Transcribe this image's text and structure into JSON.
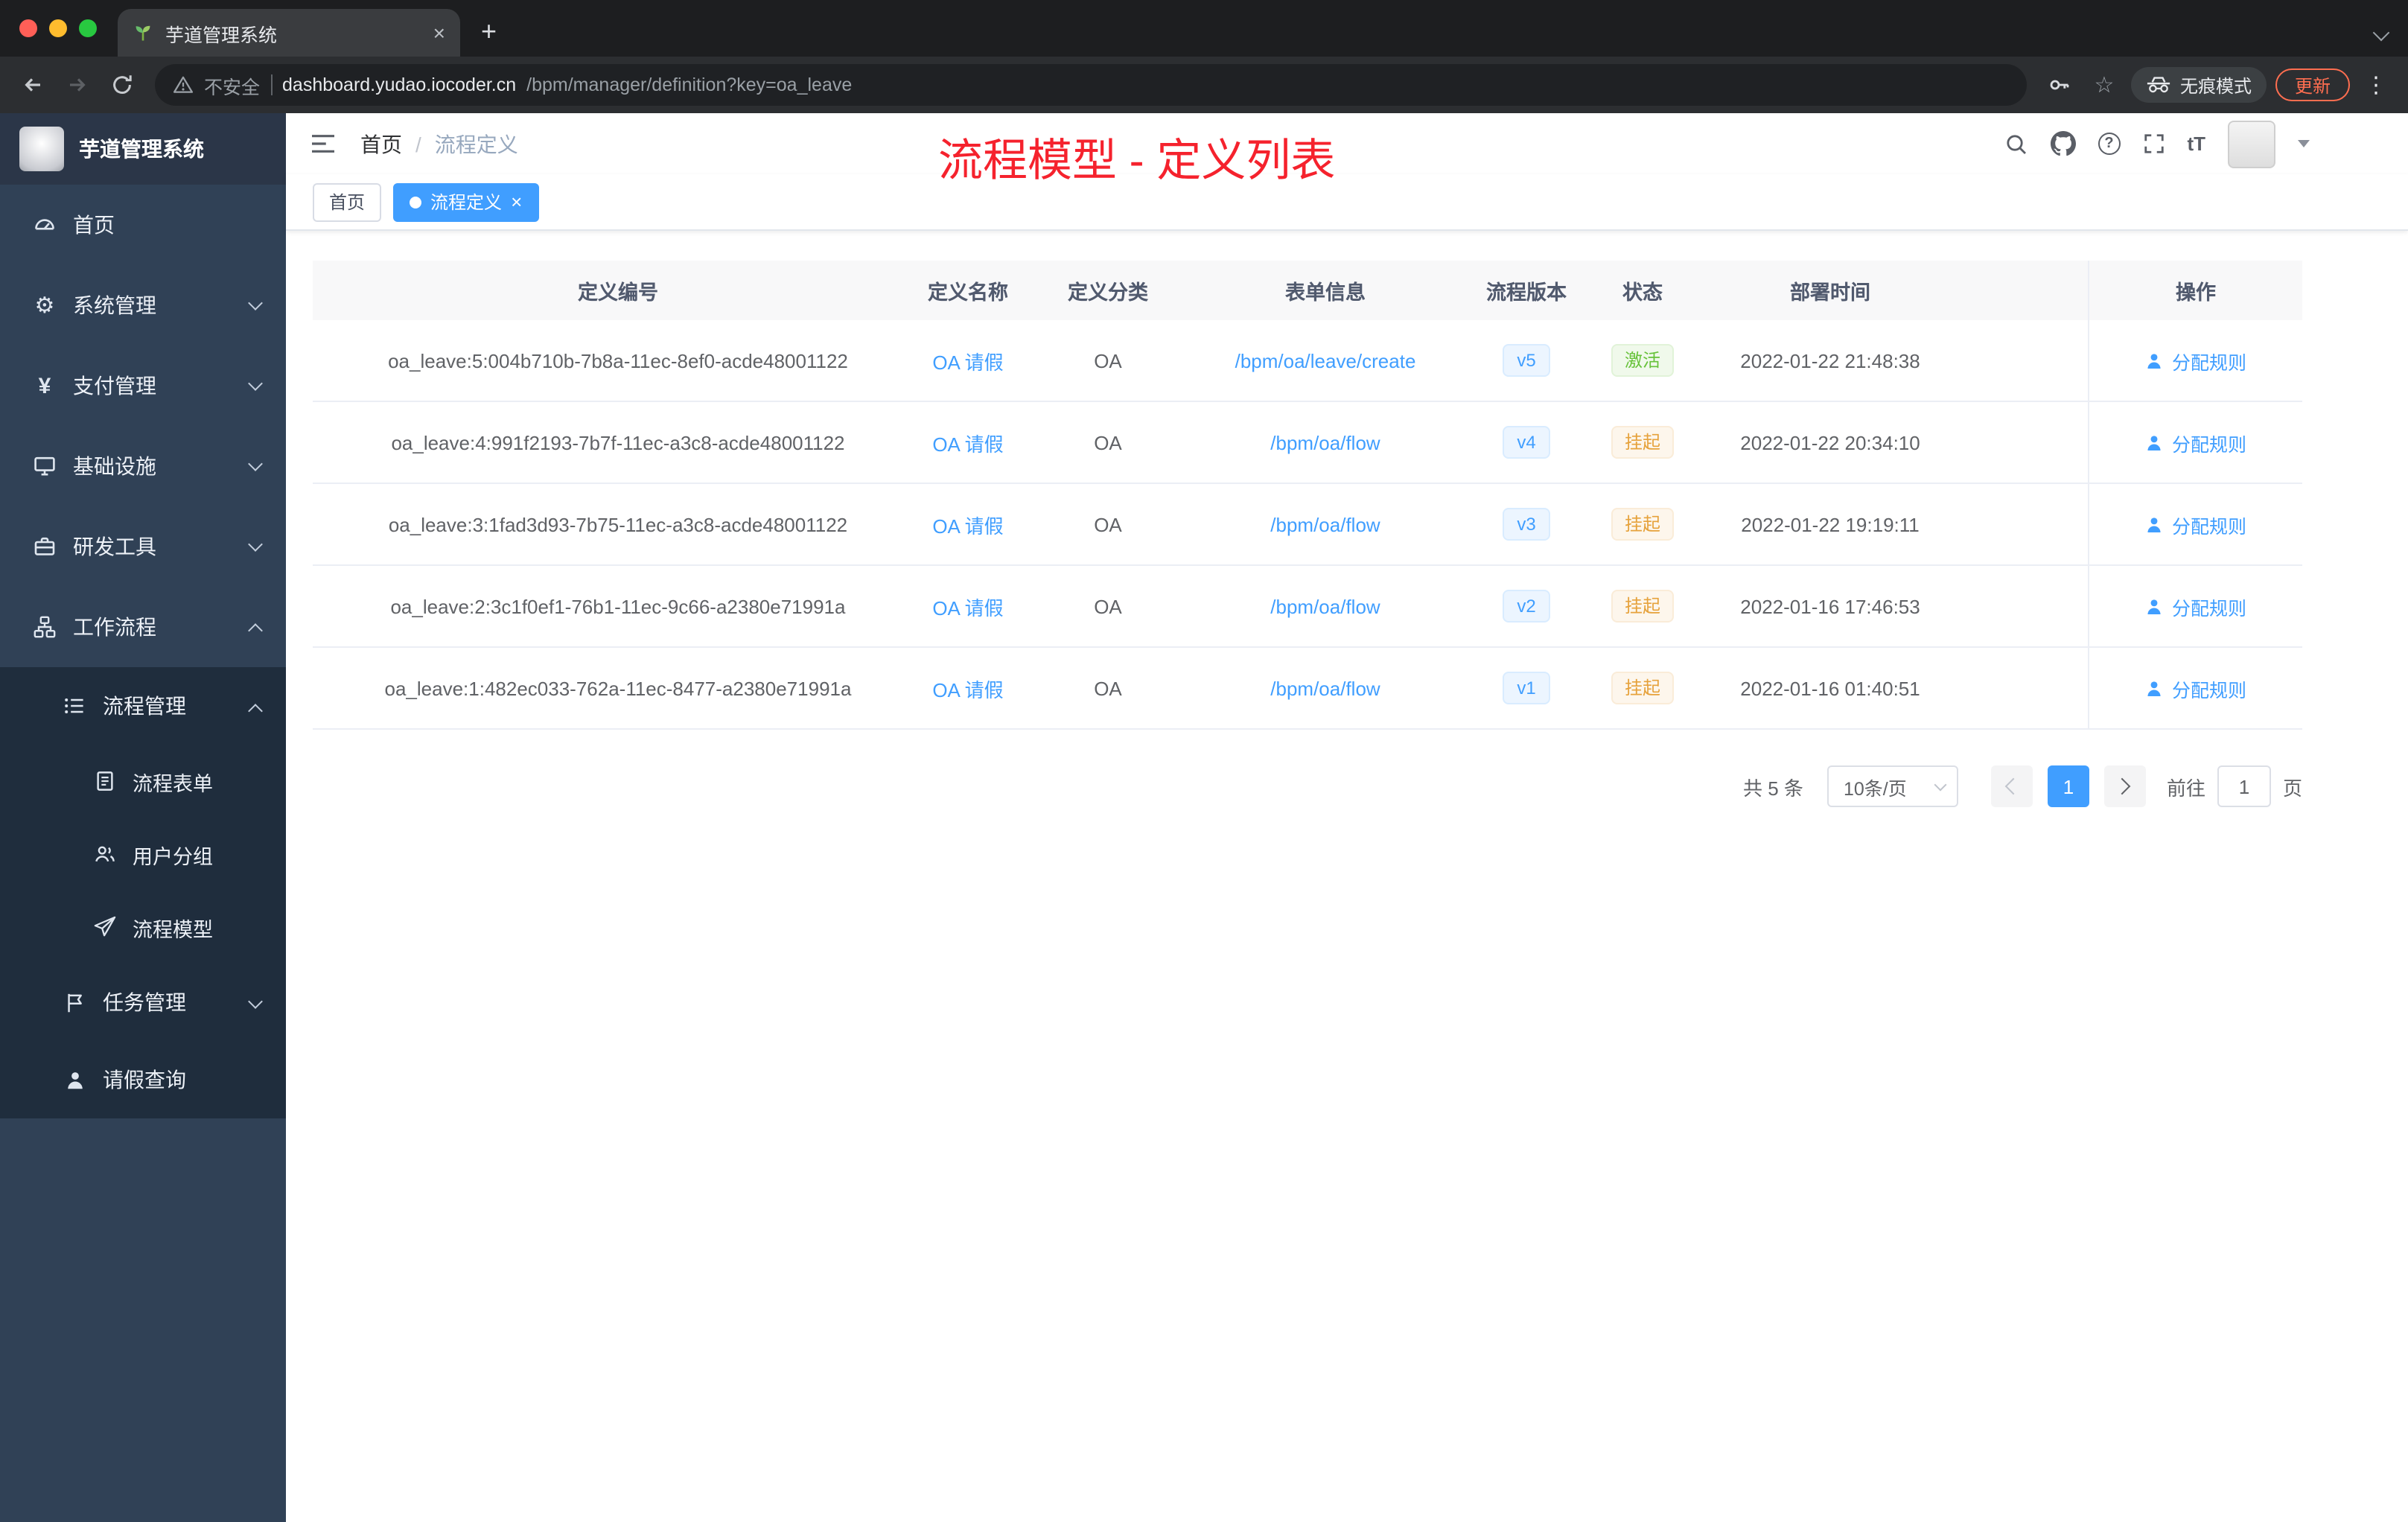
{
  "theme": {
    "accent": "#409eff",
    "success_text": "#67c23a",
    "warning_text": "#e6a23c",
    "annotation_red": "#f5222d",
    "sidebar_bg": "#304156",
    "submenu_bg": "#1f2d3d",
    "traffic_lights": [
      "#ff5f57",
      "#febc2e",
      "#28c840"
    ]
  },
  "browser": {
    "tab_title": "芋道管理系统",
    "close_glyph": "×",
    "new_tab_glyph": "+",
    "security_label": "不安全",
    "url_host": "dashboard.yudao.iocoder.cn",
    "url_path": "/bpm/manager/definition?key=oa_leave",
    "incognito_label": "无痕模式",
    "update_label": "更新",
    "kebab_glyph": "⋮",
    "star_glyph": "☆"
  },
  "sidebar": {
    "logo_title": "芋道管理系统",
    "gear_glyph": "⚙",
    "yen_glyph": "¥",
    "items": [
      {
        "label": "首页"
      },
      {
        "label": "系统管理"
      },
      {
        "label": "支付管理"
      },
      {
        "label": "基础设施"
      },
      {
        "label": "研发工具"
      },
      {
        "label": "工作流程"
      },
      {
        "label": "流程管理"
      },
      {
        "label": "流程表单"
      },
      {
        "label": "用户分组"
      },
      {
        "label": "流程模型"
      },
      {
        "label": "任务管理"
      },
      {
        "label": "请假查询"
      }
    ]
  },
  "header": {
    "breadcrumb_home": "首页",
    "breadcrumb_separator": "/",
    "breadcrumb_current": "流程定义",
    "question_glyph": "?",
    "font_size_glyph": "tT"
  },
  "annotation": {
    "text": "流程模型 - 定义列表",
    "color": "#f5222d"
  },
  "tags": [
    {
      "label": "首页",
      "active": false
    },
    {
      "label": "流程定义",
      "active": true,
      "close_glyph": "×"
    }
  ],
  "table": {
    "columns": [
      "定义编号",
      "定义名称",
      "定义分类",
      "表单信息",
      "流程版本",
      "状态",
      "部署时间",
      "操作"
    ],
    "action_label": "分配规则",
    "rows": [
      {
        "id": "oa_leave:5:004b710b-7b8a-11ec-8ef0-acde48001122",
        "name": "OA 请假",
        "category": "OA",
        "form": "/bpm/oa/leave/create",
        "version": "v5",
        "status": "激活",
        "status_type": "success",
        "deployed_at": "2022-01-22 21:48:38"
      },
      {
        "id": "oa_leave:4:991f2193-7b7f-11ec-a3c8-acde48001122",
        "name": "OA 请假",
        "category": "OA",
        "form": "/bpm/oa/flow",
        "version": "v4",
        "status": "挂起",
        "status_type": "warning",
        "deployed_at": "2022-01-22 20:34:10"
      },
      {
        "id": "oa_leave:3:1fad3d93-7b75-11ec-a3c8-acde48001122",
        "name": "OA 请假",
        "category": "OA",
        "form": "/bpm/oa/flow",
        "version": "v3",
        "status": "挂起",
        "status_type": "warning",
        "deployed_at": "2022-01-22 19:19:11"
      },
      {
        "id": "oa_leave:2:3c1f0ef1-76b1-11ec-9c66-a2380e71991a",
        "name": "OA 请假",
        "category": "OA",
        "form": "/bpm/oa/flow",
        "version": "v2",
        "status": "挂起",
        "status_type": "warning",
        "deployed_at": "2022-01-16 17:46:53"
      },
      {
        "id": "oa_leave:1:482ec033-762a-11ec-8477-a2380e71991a",
        "name": "OA 请假",
        "category": "OA",
        "form": "/bpm/oa/flow",
        "version": "v1",
        "status": "挂起",
        "status_type": "warning",
        "deployed_at": "2022-01-16 01:40:51"
      }
    ]
  },
  "pagination": {
    "total_label": "共 5 条",
    "page_size_label": "10条/页",
    "current_page": "1",
    "goto_label": "前往",
    "goto_value": "1",
    "page_unit_label": "页"
  }
}
